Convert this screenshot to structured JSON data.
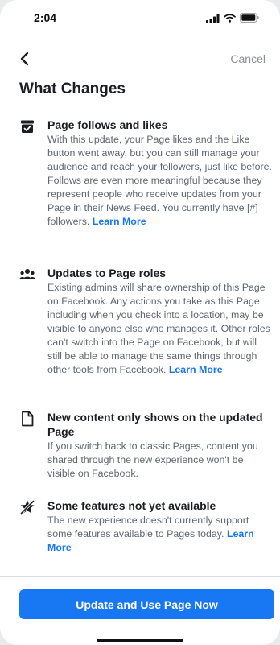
{
  "status_bar": {
    "time": "2:04"
  },
  "nav": {
    "cancel_label": "Cancel"
  },
  "page": {
    "title": "What Changes"
  },
  "sections": [
    {
      "icon": "box-check-icon",
      "heading": "Page follows and likes",
      "body": "With this update, your Page likes and the Like button went away, but you can still manage your audience and reach your followers, just like before. Follows are even more meaningful because they represent people who receive updates from your Page in their News Feed. You currently have [#] followers.",
      "link": "Learn More"
    },
    {
      "icon": "people-group-icon",
      "heading": "Updates to Page roles",
      "body": "Existing admins will share ownership of this Page on Facebook. Any actions you take as this Page, including when you check into a location, may be visible to anyone else who manages it. Other roles can't switch into the Page on Facebook, but will still be able to manage the same things through other tools from Facebook.",
      "link": "Learn More"
    },
    {
      "icon": "document-icon",
      "heading": "New content only shows on the updated Page",
      "body": "If you switch back to classic Pages, content you shared through the new experience won't be visible on Facebook."
    },
    {
      "icon": "star-off-icon",
      "heading": "Some features not yet available",
      "body": "The new experience doesn't currently support some features available to Pages today.",
      "link": "Learn More"
    }
  ],
  "footer": {
    "primary_label": "Update and Use Page Now"
  },
  "colors": {
    "accent": "#1877f2",
    "text": "#1c1e21",
    "secondary_text": "#606770"
  }
}
